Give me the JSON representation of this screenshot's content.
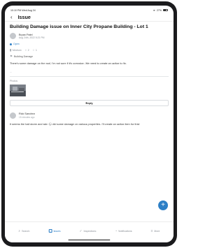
{
  "status_bar": {
    "time": "10:10 PM",
    "date": "Wed Aug 24",
    "battery": "27%"
  },
  "navbar": {
    "back_icon": "chevron-left-icon",
    "title": "Issue"
  },
  "issue": {
    "title": "Building Damage issue on Inner City Propane Building - Lot 1",
    "author_name": "Bryan Patel",
    "author_date": "Aug 24th, 2022 5:21 PM",
    "status": "Open",
    "priority": "Medium",
    "comments_count": "2",
    "attachments_count": "1",
    "tag": "Building Damage",
    "description": "There's some damage on the roof, I'm not sure if it's corrosion. We need to create an action to fix.",
    "ellipsis": "...",
    "photos_label": "Photos",
    "reply_label": "Reply"
  },
  "comment": {
    "author_name": "Rick Sanchez",
    "time": "15 minutes ago",
    "text": "It seems the hail storm and rain 🌧 did some damage on various properties. I'll create an action item for this!"
  },
  "tabs": [
    {
      "label": "Search",
      "icon": "search-icon"
    },
    {
      "label": "Issues",
      "icon": "issues-icon"
    },
    {
      "label": "Inspections",
      "icon": "check-icon"
    },
    {
      "label": "Notifications",
      "icon": "bell-icon"
    },
    {
      "label": "More",
      "icon": "menu-icon"
    }
  ],
  "colors": {
    "accent": "#2d7fc6",
    "text": "#1f2328",
    "muted": "#8a8f96"
  }
}
